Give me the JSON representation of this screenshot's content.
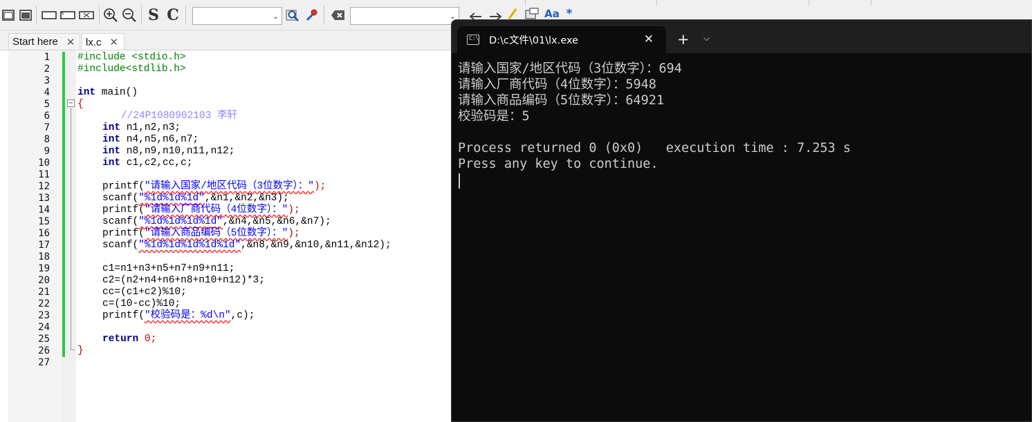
{
  "toolbar": {
    "icons": [
      "window-icon",
      "window-filled-icon",
      "box-icon",
      "box-alt-icon",
      "box-cross-icon",
      "zoom-in-icon",
      "zoom-out-icon",
      "s-letter-icon",
      "c-letter-icon",
      "search-icon",
      "wrench-icon",
      "clear-icon",
      "back-arrow-icon",
      "forward-arrow-icon",
      "highlight-icon",
      "code-icon",
      "match-case-icon",
      "regex-icon"
    ],
    "s_label": "S",
    "c_label": "C",
    "combo1_value": "",
    "combo2_value": "",
    "aa_label": "Aa",
    "star_label": "*"
  },
  "tabs": [
    {
      "label": "Start here",
      "close": "✕",
      "active": false
    },
    {
      "label": "lx.c",
      "close": "✕",
      "active": true
    }
  ],
  "editor": {
    "line_numbers": [
      "1",
      "2",
      "3",
      "4",
      "5",
      "6",
      "7",
      "8",
      "9",
      "10",
      "11",
      "12",
      "13",
      "14",
      "15",
      "16",
      "17",
      "18",
      "19",
      "20",
      "21",
      "22",
      "23",
      "24",
      "25",
      "26",
      "27"
    ],
    "fold_open": "−",
    "code": {
      "l1": "#include <stdio.h>",
      "l2": "#include<stdlib.h>",
      "l4_kw": "int",
      "l4_rest": " main()",
      "l5": "{",
      "l6": "    //24P1080902103 李轩",
      "l7_kw": "int",
      "l7_rest": " n1,n2,n3;",
      "l8_kw": "int",
      "l8_rest": " n4,n5,n6,n7;",
      "l9_kw": "int",
      "l9_rest": " n8,n9,n10,n11,n12;",
      "l10_kw": "int",
      "l10_rest": " c1,c2,cc,c;",
      "l12_a": "printf(",
      "l12_str": "\"请输入国家/地区代码（3位数字）：\"",
      "l12_b": ");",
      "l13_a": "scanf(",
      "l13_str": "\"%1d%1d%1d\"",
      "l13_b": ",&n1,&n2,&n3);",
      "l14_a": "printf(",
      "l14_str": "\"请输入厂商代码（4位数字）：\"",
      "l14_b": ");",
      "l15_a": "scanf(",
      "l15_str": "\"%1d%1d%1d%1d\"",
      "l15_b": ",&n4,&n5,&n6,&n7);",
      "l16_a": "printf(",
      "l16_str": "\"请输入商品编码（5位数字）：\"",
      "l16_b": ");",
      "l17_a": "scanf(",
      "l17_str": "\"%1d%1d%1d%1d%1d\"",
      "l17_b": ",&n8,&n9,&n10,&n11,&n12);",
      "l19": "c1=n1+n3+n5+n7+n9+n11;",
      "l20": "c2=(n2+n4+n6+n8+n10+n12)*3;",
      "l21": "cc=(c1+c2)%10;",
      "l22": "c=(10-cc)%10;",
      "l23_a": "printf(",
      "l23_str": "\"校验码是：%d\\n\"",
      "l23_b": ",c);",
      "l25_kw": "return",
      "l25_rest": " 0;",
      "l26": "}"
    }
  },
  "terminal": {
    "title": "D:\\c文件\\01\\lx.exe",
    "icon_text": "C:\\",
    "close": "✕",
    "add": "+",
    "dropdown": "⌄",
    "lines": [
      "请输入国家/地区代码（3位数字）：694",
      "请输入厂商代码（4位数字）：5948",
      "请输入商品编码（5位数字）：64921",
      "校验码是：5",
      "",
      "Process returned 0 (0x0)   execution time : 7.253 s",
      "Press any key to continue."
    ]
  }
}
